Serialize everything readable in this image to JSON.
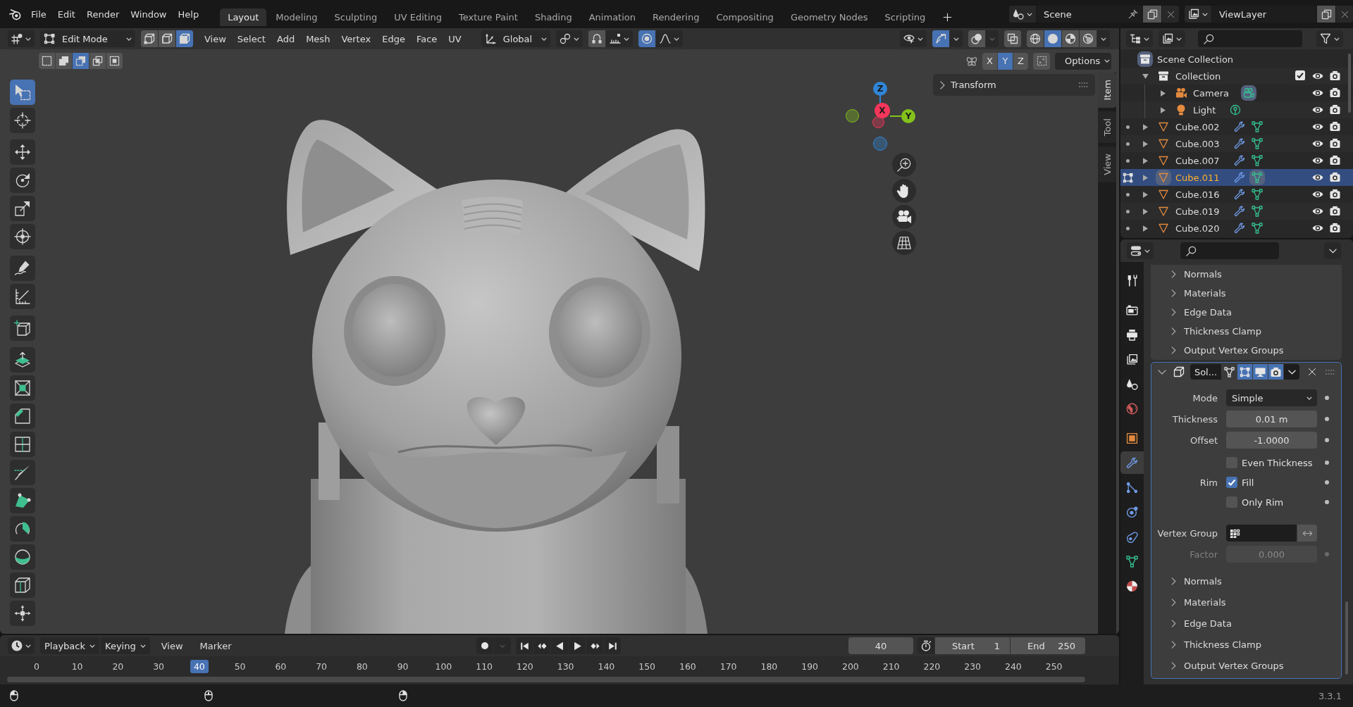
{
  "top_bar": {
    "menus": [
      "File",
      "Edit",
      "Render",
      "Window",
      "Help"
    ],
    "workspaces": [
      {
        "label": "Layout",
        "selected": true
      },
      {
        "label": "Modeling",
        "selected": false
      },
      {
        "label": "Sculpting",
        "selected": false
      },
      {
        "label": "UV Editing",
        "selected": false
      },
      {
        "label": "Texture Paint",
        "selected": false
      },
      {
        "label": "Shading",
        "selected": false
      },
      {
        "label": "Animation",
        "selected": false
      },
      {
        "label": "Rendering",
        "selected": false
      },
      {
        "label": "Compositing",
        "selected": false
      },
      {
        "label": "Geometry Nodes",
        "selected": false
      },
      {
        "label": "Scripting",
        "selected": false
      }
    ],
    "scene": "Scene",
    "view_layer": "ViewLayer"
  },
  "viewport": {
    "mode": "Edit Mode",
    "select_modes": [
      {
        "kind": "vertex",
        "selected": false
      },
      {
        "kind": "edge",
        "selected": false
      },
      {
        "kind": "face",
        "selected": true
      }
    ],
    "menus": [
      "View",
      "Select",
      "Add",
      "Mesh",
      "Vertex",
      "Edge",
      "Face",
      "UV"
    ],
    "orientation": "Global",
    "snapping": {
      "on": false
    },
    "proportional_editing": {
      "on": true
    },
    "gizmos": {
      "on": true
    },
    "overlays": {
      "on": false
    },
    "xray": {
      "on": false
    },
    "shading": [
      {
        "kind": "wireframe",
        "selected": false
      },
      {
        "kind": "solid",
        "selected": true
      },
      {
        "kind": "material",
        "selected": false
      },
      {
        "kind": "rendered",
        "selected": false
      }
    ],
    "box_select_modes": [
      {
        "kind": "new",
        "selected": false
      },
      {
        "kind": "extend",
        "selected": false
      },
      {
        "kind": "subtract",
        "selected": true
      },
      {
        "kind": "invert",
        "selected": false
      },
      {
        "kind": "intersect",
        "selected": false
      }
    ],
    "mirror_axes": [
      {
        "label": "X",
        "selected": false
      },
      {
        "label": "Y",
        "selected": true
      },
      {
        "label": "Z",
        "selected": false
      }
    ],
    "options": "Options",
    "tools": [
      {
        "kind": "select_box",
        "selected": true
      },
      {
        "kind": "cursor",
        "selected": false
      },
      {
        "kind": "move",
        "selected": false
      },
      {
        "kind": "rotate",
        "selected": false
      },
      {
        "kind": "scale",
        "selected": false
      },
      {
        "kind": "transform",
        "selected": false
      },
      {
        "kind": "annotate",
        "selected": false
      },
      {
        "kind": "measure",
        "selected": false
      },
      {
        "kind": "add_cube",
        "selected": false
      },
      {
        "kind": "extrude",
        "selected": false
      },
      {
        "kind": "inset",
        "selected": false
      },
      {
        "kind": "bevel",
        "selected": false
      },
      {
        "kind": "loop_cut",
        "selected": false
      },
      {
        "kind": "knife",
        "selected": false
      },
      {
        "kind": "poly_build",
        "selected": false
      },
      {
        "kind": "spin",
        "selected": false
      },
      {
        "kind": "smooth",
        "selected": false
      },
      {
        "kind": "edge_slide",
        "selected": false
      },
      {
        "kind": "shrink_fatten",
        "selected": false
      }
    ],
    "gizmo_axes": [
      {
        "label": "X",
        "color": "#f5365a"
      },
      {
        "label": "Y",
        "color": "#84c21b"
      },
      {
        "label": "Z",
        "color": "#2f86d8"
      }
    ],
    "sidebar": {
      "panel": {
        "title": "Transform",
        "expanded": false
      },
      "tabs": [
        {
          "label": "Item",
          "selected": true
        },
        {
          "label": "Tool",
          "selected": false
        },
        {
          "label": "View",
          "selected": false
        }
      ]
    }
  },
  "outliner": {
    "root": "Scene Collection",
    "items": [
      {
        "kind": "collection",
        "name": "Collection",
        "expanded": true,
        "checked": true,
        "selected": false,
        "editing": false,
        "children": [
          {
            "kind": "camera",
            "name": "Camera",
            "expanded": false,
            "selected": false,
            "editing": false,
            "data_active": true
          },
          {
            "kind": "light",
            "name": "Light",
            "expanded": false,
            "selected": false,
            "editing": false,
            "data_active": false
          }
        ]
      },
      {
        "kind": "mesh",
        "name": "Cube.002",
        "expanded": false,
        "selected": false,
        "editing": false,
        "data_active": false
      },
      {
        "kind": "mesh",
        "name": "Cube.003",
        "expanded": false,
        "selected": false,
        "editing": false,
        "data_active": false
      },
      {
        "kind": "mesh",
        "name": "Cube.007",
        "expanded": false,
        "selected": false,
        "editing": false,
        "data_active": false
      },
      {
        "kind": "mesh",
        "name": "Cube.011",
        "expanded": false,
        "selected": true,
        "editing": true,
        "data_active": true
      },
      {
        "kind": "mesh",
        "name": "Cube.016",
        "expanded": false,
        "selected": false,
        "editing": false,
        "data_active": false
      },
      {
        "kind": "mesh",
        "name": "Cube.019",
        "expanded": false,
        "selected": false,
        "editing": false,
        "data_active": false
      },
      {
        "kind": "mesh",
        "name": "Cube.020",
        "expanded": false,
        "selected": false,
        "editing": false,
        "data_active": false
      }
    ]
  },
  "properties": {
    "tabs": [
      {
        "kind": "tool",
        "selected": false
      },
      {
        "kind": "render",
        "selected": false
      },
      {
        "kind": "output",
        "selected": false
      },
      {
        "kind": "view_layer",
        "selected": false
      },
      {
        "kind": "scene",
        "selected": false
      },
      {
        "kind": "world",
        "selected": false
      },
      {
        "kind": "object",
        "selected": false
      },
      {
        "kind": "modifiers",
        "selected": true
      },
      {
        "kind": "particles",
        "selected": false
      },
      {
        "kind": "physics",
        "selected": false
      },
      {
        "kind": "constraints",
        "selected": false
      },
      {
        "kind": "data",
        "selected": false
      },
      {
        "kind": "material",
        "selected": false
      }
    ],
    "previous_subpanels": [
      {
        "label": "Normals",
        "expanded": false
      },
      {
        "label": "Materials",
        "expanded": false
      },
      {
        "label": "Edge Data",
        "expanded": false
      },
      {
        "label": "Thickness Clamp",
        "expanded": false
      },
      {
        "label": "Output Vertex Groups",
        "expanded": false
      }
    ],
    "modifier": {
      "name": "Sol...",
      "expanded": true,
      "toggles": [
        {
          "kind": "on_cage",
          "on": false
        },
        {
          "kind": "edit_mode",
          "on": true
        },
        {
          "kind": "viewport",
          "on": true
        },
        {
          "kind": "render",
          "on": true
        }
      ],
      "rows": [
        {
          "kind": "dropdown",
          "label": "Mode",
          "value": "Simple"
        },
        {
          "kind": "number",
          "label": "Thickness",
          "value": "0.01 m",
          "disabled": false
        },
        {
          "kind": "number",
          "label": "Offset",
          "value": "-1.0000",
          "disabled": false
        },
        {
          "kind": "checkbox",
          "text": "Even Thickness",
          "checked": false
        },
        {
          "kind": "checkbox",
          "label": "Rim",
          "text": "Fill",
          "checked": true
        },
        {
          "kind": "checkbox",
          "text": "Only Rim",
          "checked": false
        },
        {
          "kind": "vertex_group",
          "label": "Vertex Group"
        },
        {
          "kind": "number",
          "label": "Factor",
          "value": "0.000",
          "disabled": true
        }
      ],
      "subpanels": [
        {
          "label": "Normals",
          "expanded": false
        },
        {
          "label": "Materials",
          "expanded": false
        },
        {
          "label": "Edge Data",
          "expanded": false
        },
        {
          "label": "Thickness Clamp",
          "expanded": false
        },
        {
          "label": "Output Vertex Groups",
          "expanded": false
        }
      ]
    }
  },
  "timeline": {
    "menus": [
      {
        "kind": "dropdown",
        "label": "Playback"
      },
      {
        "kind": "dropdown",
        "label": "Keying"
      },
      {
        "kind": "menu",
        "label": "View"
      },
      {
        "kind": "menu",
        "label": "Marker"
      }
    ],
    "auto_keying": {
      "on": false
    },
    "current_frame": "40",
    "start": {
      "label": "Start",
      "value": "1"
    },
    "end": {
      "label": "End",
      "value": "250"
    },
    "frames": [
      {
        "label": "0",
        "selected": false
      },
      {
        "label": "10",
        "selected": false
      },
      {
        "label": "20",
        "selected": false
      },
      {
        "label": "30",
        "selected": false
      },
      {
        "label": "40",
        "selected": true
      },
      {
        "label": "50",
        "selected": false
      },
      {
        "label": "60",
        "selected": false
      },
      {
        "label": "70",
        "selected": false
      },
      {
        "label": "80",
        "selected": false
      },
      {
        "label": "90",
        "selected": false
      },
      {
        "label": "100",
        "selected": false
      },
      {
        "label": "110",
        "selected": false
      },
      {
        "label": "120",
        "selected": false
      },
      {
        "label": "130",
        "selected": false
      },
      {
        "label": "140",
        "selected": false
      },
      {
        "label": "150",
        "selected": false
      },
      {
        "label": "160",
        "selected": false
      },
      {
        "label": "170",
        "selected": false
      },
      {
        "label": "180",
        "selected": false
      },
      {
        "label": "190",
        "selected": false
      },
      {
        "label": "200",
        "selected": false
      },
      {
        "label": "210",
        "selected": false
      },
      {
        "label": "220",
        "selected": false
      },
      {
        "label": "230",
        "selected": false
      },
      {
        "label": "240",
        "selected": false
      },
      {
        "label": "250",
        "selected": false
      }
    ]
  },
  "status_bar": {
    "version": "3.3.1"
  }
}
